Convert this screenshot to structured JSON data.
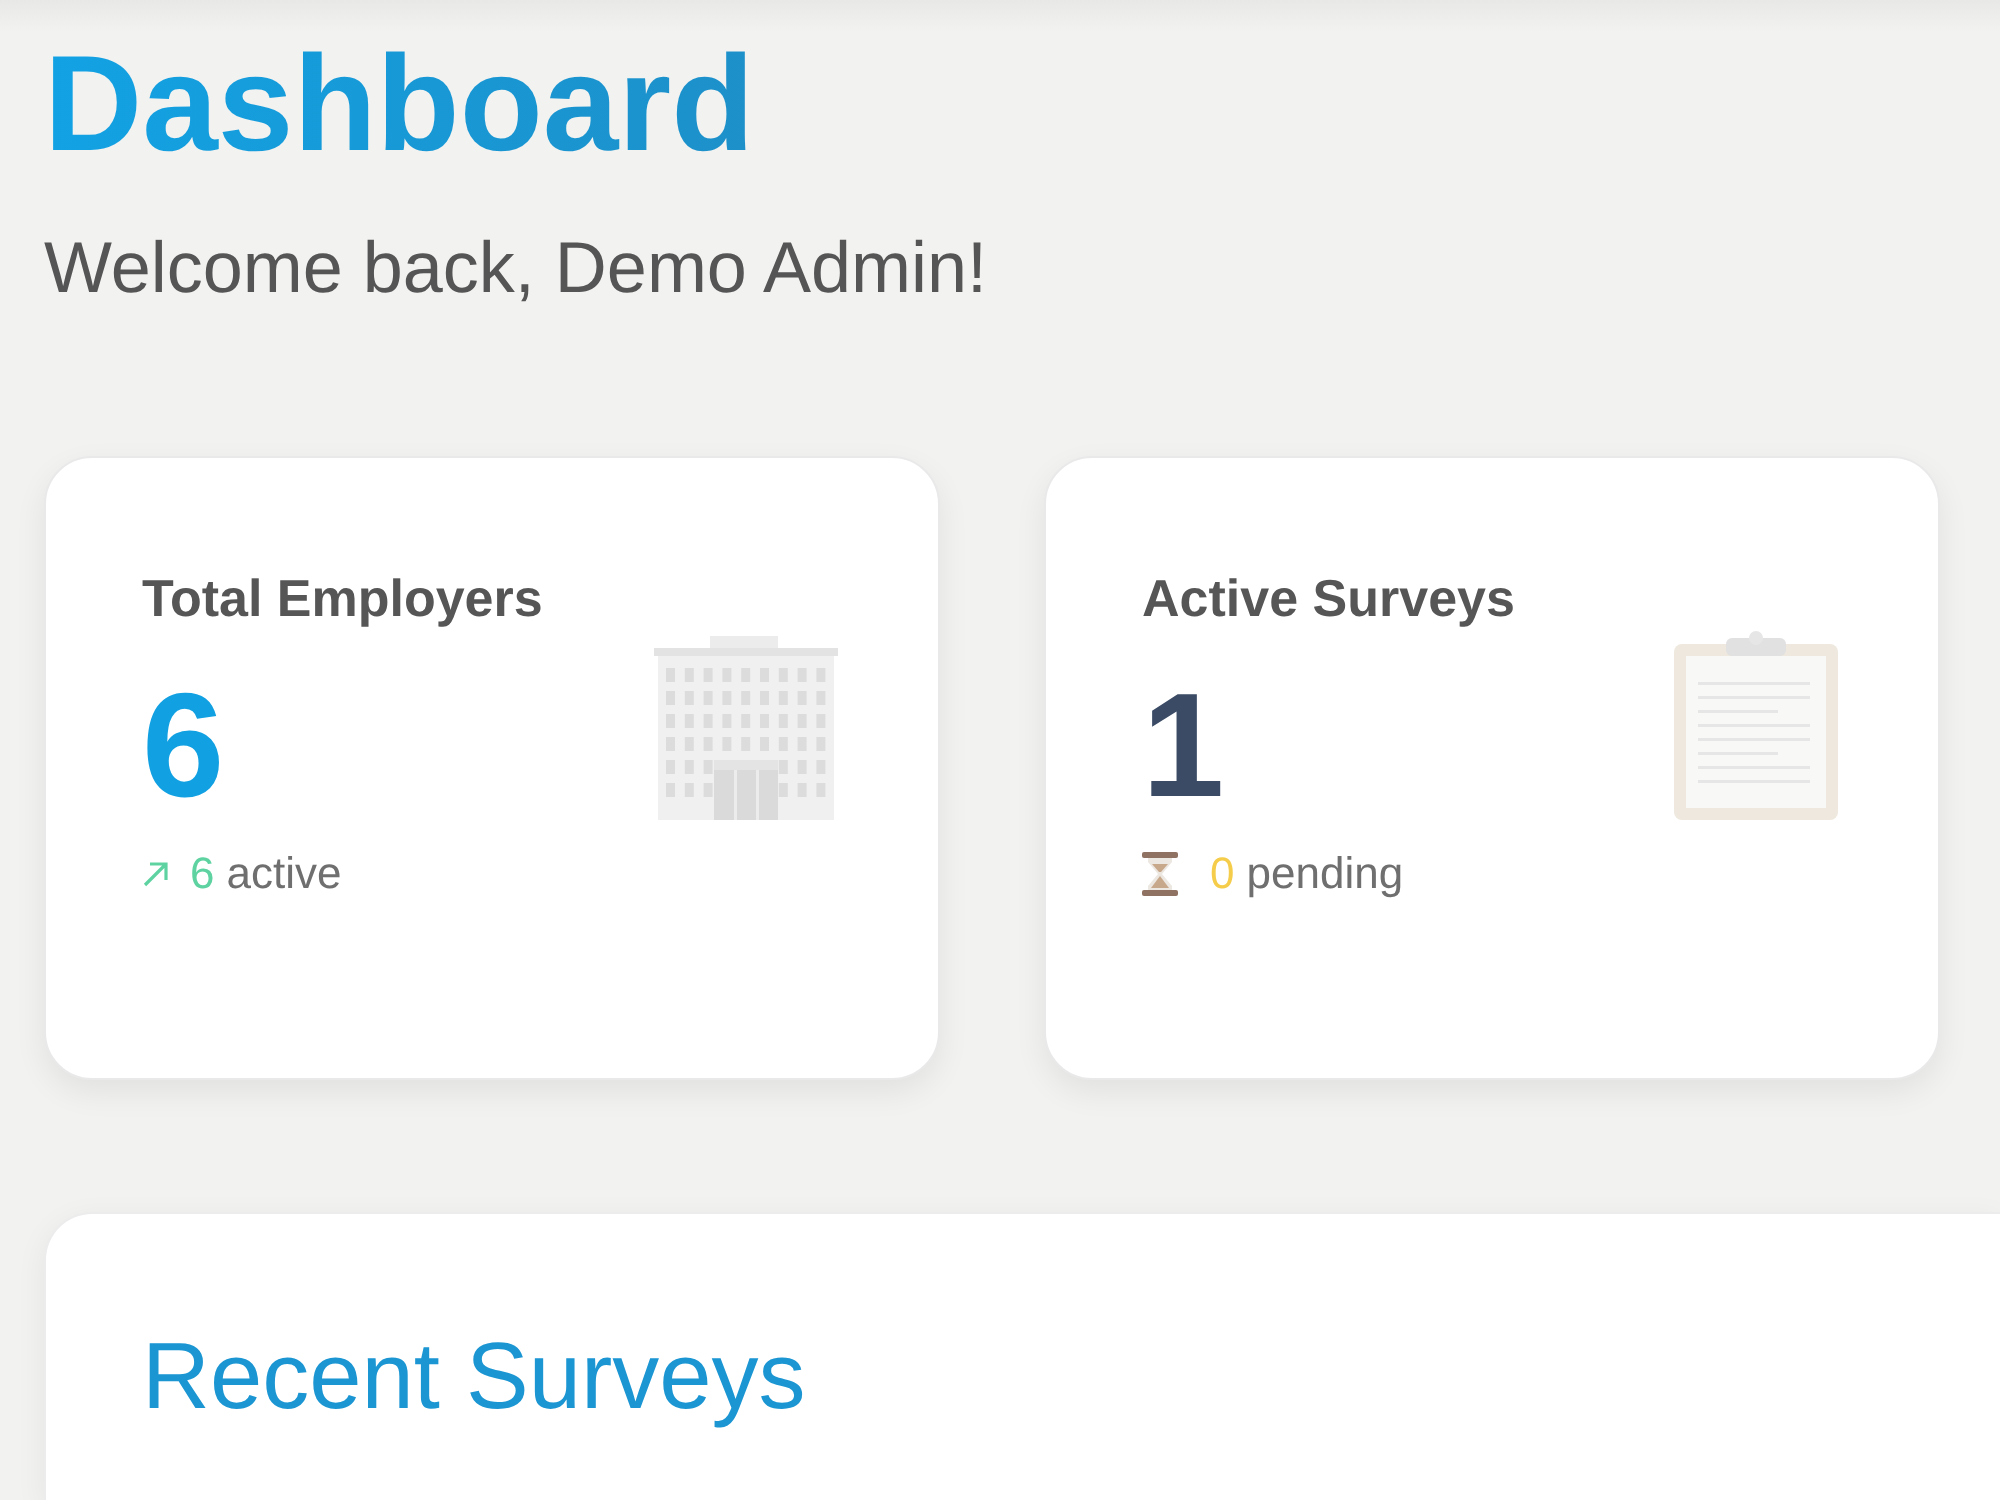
{
  "header": {
    "title": "Dashboard",
    "subtitle": "Welcome back, Demo Admin!"
  },
  "stats": [
    {
      "kind": "employers",
      "label": "Total Employers",
      "value": "6",
      "trend": {
        "kind": "up",
        "count": "6",
        "text": "active"
      }
    },
    {
      "kind": "surveys",
      "label": "Active Surveys",
      "value": "1",
      "trend": {
        "kind": "pending",
        "count": "0",
        "text": "pending"
      }
    }
  ],
  "recent_surveys": {
    "title": "Recent Surveys"
  }
}
